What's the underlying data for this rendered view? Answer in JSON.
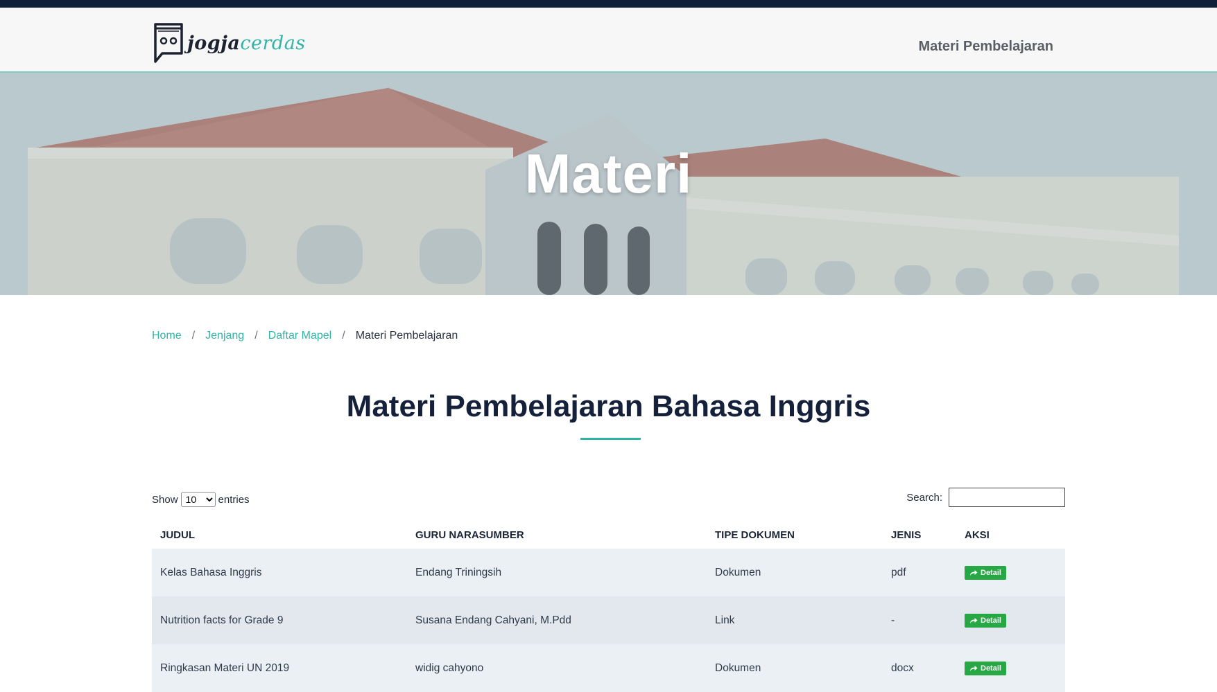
{
  "header": {
    "logo_part1": "jogja",
    "logo_part2": "cerdas",
    "nav_link": "Materi Pembelajaran"
  },
  "hero": {
    "title": "Materi"
  },
  "breadcrumb": {
    "items": [
      "Home",
      "Jenjang",
      "Daftar Mapel"
    ],
    "current": "Materi Pembelajaran",
    "separator": "/"
  },
  "page_title": "Materi Pembelajaran Bahasa Inggris",
  "table_controls": {
    "show_label": "Show",
    "entries_value": "10",
    "entries_label": "entries",
    "search_label": "Search:"
  },
  "table": {
    "headers": [
      "JUDUL",
      "GURU NARASUMBER",
      "TIPE DOKUMEN",
      "JENIS",
      "AKSI"
    ],
    "rows": [
      {
        "judul": "Kelas Bahasa Inggris",
        "guru": "Endang Triningsih",
        "tipe": "Dokumen",
        "jenis": "pdf",
        "aksi": "Detail"
      },
      {
        "judul": "Nutrition facts for Grade 9",
        "guru": "Susana Endang Cahyani, M.Pdd",
        "tipe": "Link",
        "jenis": "-",
        "aksi": "Detail"
      },
      {
        "judul": "Ringkasan Materi UN 2019",
        "guru": "widig cahyono",
        "tipe": "Dokumen",
        "jenis": "docx",
        "aksi": "Detail"
      }
    ]
  },
  "colors": {
    "accent": "#2fb5a5",
    "dark": "#15213a",
    "button_green": "#28a745"
  },
  "icons": {
    "logo": "chat-bubble-icon",
    "detail": "share-arrow-icon"
  }
}
